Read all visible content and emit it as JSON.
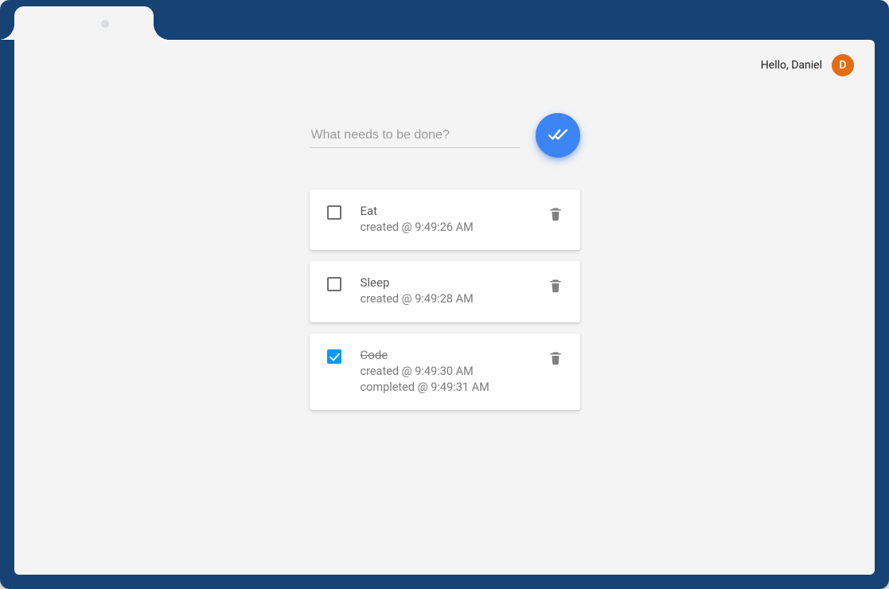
{
  "header": {
    "greeting": "Hello, Daniel",
    "avatar_letter": "D"
  },
  "input": {
    "placeholder": "What needs to be done?",
    "value": ""
  },
  "colors": {
    "frame": "#174274",
    "fab": "#3d84f5",
    "checkbox_checked": "#009cf3",
    "avatar": "#e46c14"
  },
  "todos": [
    {
      "title": "Eat",
      "completed": false,
      "created_line": "created @ 9:49:26 AM",
      "completed_line": ""
    },
    {
      "title": "Sleep",
      "completed": false,
      "created_line": "created @ 9:49:28 AM",
      "completed_line": ""
    },
    {
      "title": "Code",
      "completed": true,
      "created_line": "created @ 9:49:30 AM",
      "completed_line": "completed @ 9:49:31 AM"
    }
  ]
}
